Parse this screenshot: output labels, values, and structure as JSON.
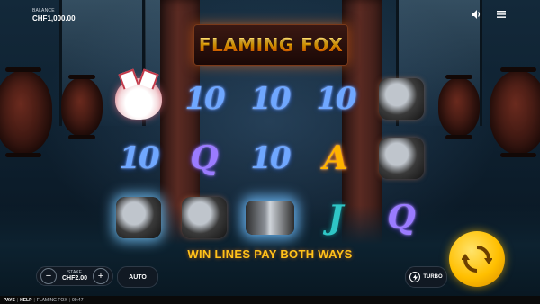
{
  "balance": {
    "label": "BALANCE",
    "value": "CHF1,000.00"
  },
  "top_icons": [
    {
      "name": "sound-icon"
    },
    {
      "name": "menu-icon"
    }
  ],
  "logo": {
    "text": "FLAMING FOX"
  },
  "reels": [
    [
      "mask",
      "10",
      "tool"
    ],
    [
      "10",
      "Q",
      "tool"
    ],
    [
      "10",
      "10",
      "scroll"
    ],
    [
      "10",
      "A",
      "J"
    ],
    [
      "tool",
      "tool",
      "Q"
    ]
  ],
  "message": "WIN LINES PAY BOTH WAYS",
  "stake": {
    "label": "STAKE",
    "value": "CHF2.00",
    "minus": "−",
    "plus": "+"
  },
  "auto_label": "AUTO",
  "turbo_label": "TURBO",
  "footer": {
    "pays": "PAYS",
    "help": "HELP",
    "game": "FLAMING FOX",
    "time": "09:47"
  },
  "colors": {
    "accent_gold": "#ffbf00",
    "ten_blue": "#6fa7ff",
    "q_purple": "#9a7bff",
    "a_orange": "#ffb300",
    "j_teal": "#2fc6c6"
  }
}
